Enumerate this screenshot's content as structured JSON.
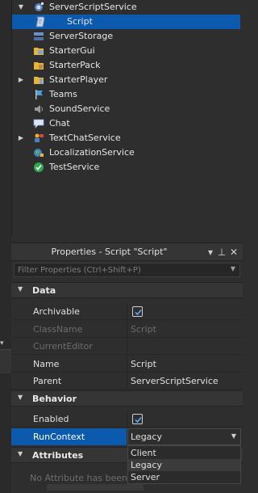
{
  "explorer": {
    "items": [
      {
        "label": "ServerScriptService",
        "icon": "server-script-service-icon",
        "arrow": "expanded"
      },
      {
        "label": "Script",
        "icon": "script-icon",
        "selected": true
      },
      {
        "label": "ServerStorage",
        "icon": "server-storage-icon"
      },
      {
        "label": "StarterGui",
        "icon": "starter-gui-icon"
      },
      {
        "label": "StarterPack",
        "icon": "starter-pack-icon"
      },
      {
        "label": "StarterPlayer",
        "icon": "starter-player-icon",
        "arrow": "collapsed"
      },
      {
        "label": "Teams",
        "icon": "teams-icon"
      },
      {
        "label": "SoundService",
        "icon": "sound-service-icon"
      },
      {
        "label": "Chat",
        "icon": "chat-icon"
      },
      {
        "label": "TextChatService",
        "icon": "text-chat-service-icon",
        "arrow": "collapsed"
      },
      {
        "label": "LocalizationService",
        "icon": "localization-service-icon"
      },
      {
        "label": "TestService",
        "icon": "test-service-icon"
      }
    ]
  },
  "properties": {
    "title": "Properties - Script \"Script\"",
    "filter_placeholder": "Filter Properties (Ctrl+Shift+P)",
    "sections": {
      "data": "Data",
      "behavior": "Behavior",
      "attributes": "Attributes"
    },
    "rows": {
      "archivable": {
        "name": "Archivable"
      },
      "classname": {
        "name": "ClassName",
        "value": "Script"
      },
      "currenteditor": {
        "name": "CurrentEditor"
      },
      "name": {
        "name": "Name",
        "value": "Script"
      },
      "parent": {
        "name": "Parent",
        "value": "ServerScriptService"
      },
      "enabled": {
        "name": "Enabled"
      },
      "runcontext": {
        "name": "RunContext",
        "value": "Legacy"
      }
    },
    "runcontext_options": [
      "Client",
      "Legacy",
      "Server"
    ],
    "no_attributes": "No Attribute has been ad"
  },
  "colors": {
    "selection": "#0b5aad",
    "background": "#2e2e2e",
    "header": "#353535"
  }
}
